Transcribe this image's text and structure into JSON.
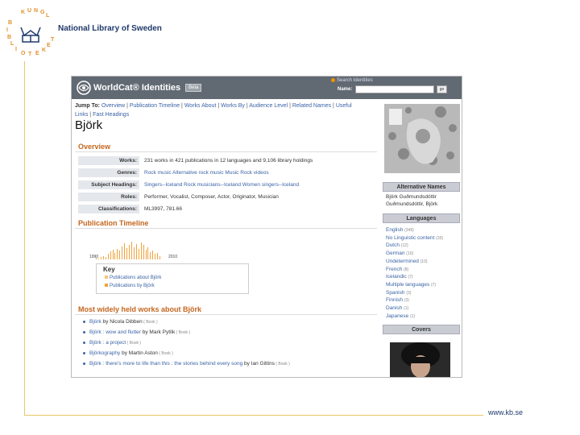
{
  "slide": {
    "org_name": "National Library of Sweden",
    "logo_letters": "KUNGL BIBLIOTEKET",
    "footer_url": "www.kb.se"
  },
  "worldcat": {
    "title": "WorldCat® Identities",
    "beta": "Beta",
    "search_label": "Search Identities",
    "name_label": "Name:",
    "name_value": "",
    "go_label": "go"
  },
  "jump": {
    "label": "Jump To:",
    "links": [
      "Overview",
      "Publication Timeline",
      "Works About",
      "Works By",
      "Audience Level",
      "Related Names",
      "Useful Links",
      "Fast Headings"
    ]
  },
  "identity_name": "Björk",
  "overview": {
    "title": "Overview",
    "rows": [
      {
        "label": "Works:",
        "value": "231 works in 421 publications in 12 languages and 9,106 library holdings",
        "link": false
      },
      {
        "label": "Genres:",
        "value": "Rock music  Alternative rock music  Music  Rock videos",
        "link": true
      },
      {
        "label": "Subject Headings:",
        "value": "Singers--Iceland  Rock musicians--Iceland  Women singers--Iceland",
        "link": true
      },
      {
        "label": "Roles:",
        "value": "Performer, Vocalist, Composer, Actor, Originator, Musician",
        "link": false
      },
      {
        "label": "Classifications:",
        "value": "ML3997, 781.66",
        "link": false
      }
    ]
  },
  "timeline": {
    "title": "Publication Timeline",
    "year_start": "1990",
    "year_end": "2010",
    "bars": [
      0.1,
      0.05,
      0.15,
      0.2,
      0.12,
      0.3,
      0.45,
      0.55,
      0.35,
      0.6,
      0.5,
      0.75,
      0.9,
      0.65,
      0.8,
      1.0,
      0.7,
      0.85,
      0.6,
      0.95,
      0.8,
      0.55,
      0.7,
      0.4,
      0.5,
      0.3,
      0.35,
      0.2
    ],
    "key_title": "Key",
    "key_items": [
      {
        "label": "Publications about Björk",
        "color": "#f6c27a"
      },
      {
        "label": "Publications by Björk",
        "color": "#f0a33b"
      }
    ]
  },
  "works": {
    "title": "Most widely held works about Björk",
    "items": [
      {
        "title": "Björk",
        "by": " by Nicola Dibben",
        "format": " ( Book )"
      },
      {
        "title": "Björk : wow and flutter",
        "by": " by Mark Pytlik",
        "format": " ( Book )"
      },
      {
        "title": "Björk : a project",
        "by": "",
        "format": " ( Book )"
      },
      {
        "title": "Björkography",
        "by": " by Martin Aston",
        "format": " ( Book )"
      },
      {
        "title": "Björk : there's more to life than this : the stories behind every song",
        "by": " by Ian Gittins",
        "format": " ( Book )"
      }
    ]
  },
  "sidebar": {
    "alt_names_title": "Alternative Names",
    "alt_names": [
      "Björk Guðmundsdóttir",
      "Guðmundsdóttir, Björk"
    ],
    "languages_title": "Languages",
    "languages": [
      {
        "name": "English",
        "count": "(349)"
      },
      {
        "name": "No Linguistic content",
        "count": "(33)"
      },
      {
        "name": "Dutch",
        "count": "(12)"
      },
      {
        "name": "German",
        "count": "(10)"
      },
      {
        "name": "Undetermined",
        "count": "(10)"
      },
      {
        "name": "French",
        "count": "(8)"
      },
      {
        "name": "Icelandic",
        "count": "(7)"
      },
      {
        "name": "Multiple languages",
        "count": "(7)"
      },
      {
        "name": "Spanish",
        "count": "(3)"
      },
      {
        "name": "Finnish",
        "count": "(3)"
      },
      {
        "name": "Danish",
        "count": "(1)"
      },
      {
        "name": "Japanese",
        "count": "(1)"
      }
    ],
    "covers_title": "Covers"
  }
}
